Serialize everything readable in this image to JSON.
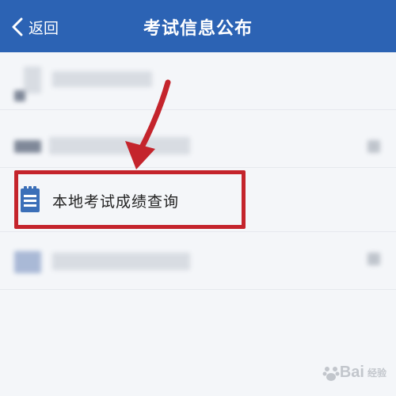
{
  "nav": {
    "back_label": "返回",
    "title": "考试信息公布"
  },
  "list": {
    "highlighted_item_label": "本地考试成绩查询"
  },
  "watermark": {
    "brand": "Bai",
    "suffix": "经验"
  },
  "colors": {
    "nav_bg": "#2c63b4",
    "highlight_red": "#c4242c"
  },
  "icons": [
    "chevron-left-icon",
    "document-icon",
    "red-arrow-annotation",
    "baidu-paw-logo"
  ]
}
